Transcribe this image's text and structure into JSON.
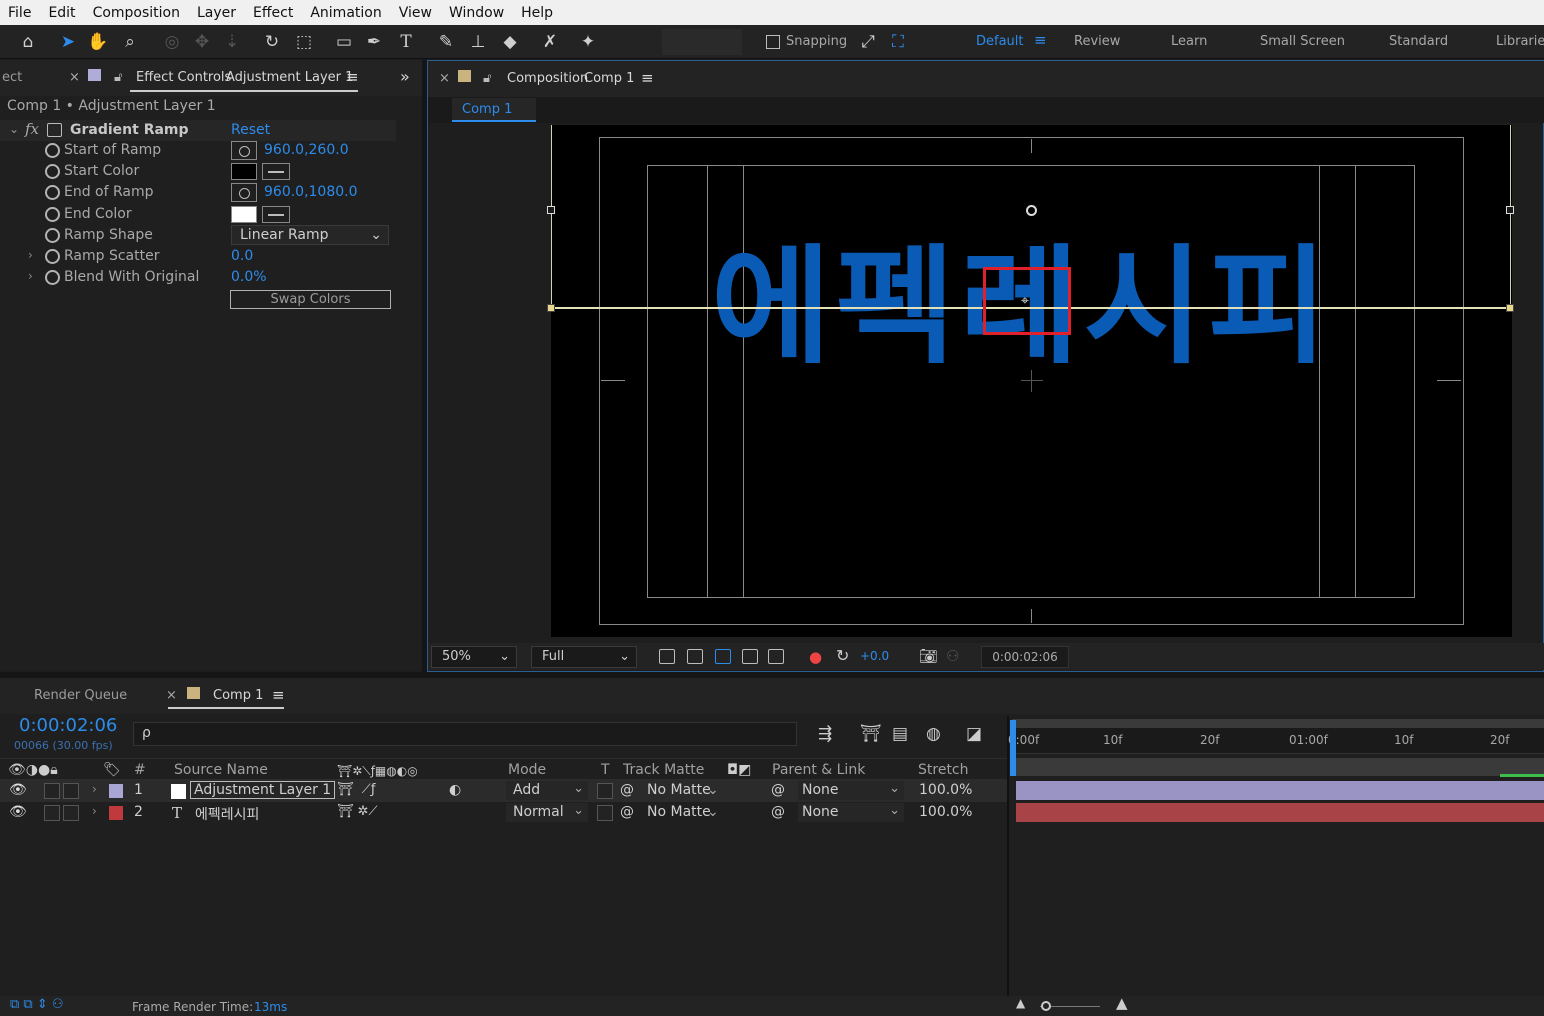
{
  "menu": [
    "File",
    "Edit",
    "Composition",
    "Layer",
    "Effect",
    "Animation",
    "View",
    "Window",
    "Help"
  ],
  "toolbar": {
    "snapping_label": "Snapping",
    "workspaces": [
      "Default",
      "Review",
      "Learn",
      "Small Screen",
      "Standard",
      "Libraries"
    ],
    "active_workspace": "Default"
  },
  "effect_controls": {
    "cut_tab": "ect",
    "tab_label": "Effect Controls",
    "tab_layer": "Adjustment Layer 1",
    "breadcrumb": "Comp 1 • Adjustment Layer 1",
    "effect_name": "Gradient Ramp",
    "reset_label": "Reset",
    "fx_label": "fx",
    "props": {
      "start_of_ramp": {
        "label": "Start of Ramp",
        "value": "960.0,260.0"
      },
      "start_color": {
        "label": "Start Color",
        "color": "#000000"
      },
      "end_of_ramp": {
        "label": "End of Ramp",
        "value": "960.0,1080.0"
      },
      "end_color": {
        "label": "End Color",
        "color": "#ffffff"
      },
      "ramp_shape": {
        "label": "Ramp Shape",
        "value": "Linear Ramp"
      },
      "ramp_scatter": {
        "label": "Ramp Scatter",
        "value": "0.0"
      },
      "blend_with_original": {
        "label": "Blend With Original",
        "value": "0.0%"
      }
    },
    "swap_colors_label": "Swap Colors"
  },
  "composition": {
    "tab_label": "Composition",
    "tab_comp": "Comp 1",
    "sub_tab": "Comp 1",
    "text": "에펙레시피",
    "text_color": "#0a5bb5",
    "highlight_color": "#e0202a",
    "zoom": "50%",
    "resolution": "Full",
    "exposure": "+0.0",
    "timecode": "0:00:02:06"
  },
  "timeline": {
    "render_queue_tab": "Render Queue",
    "comp_tab": "Comp 1",
    "timecode": "0:00:02:06",
    "frame_info": "00066 (30.00 fps)",
    "search_icon_label": "ρ",
    "columns": {
      "num": "#",
      "source_name": "Source Name",
      "mode": "Mode",
      "t": "T",
      "track_matte": "Track Matte",
      "parent_link": "Parent & Link",
      "stretch": "Stretch"
    },
    "ruler_labels": [
      "0:00f",
      "10f",
      "20f",
      "01:00f",
      "10f",
      "20f"
    ],
    "layers": [
      {
        "num": "1",
        "name": "Adjustment Layer 1",
        "label_color": "#a9a6d6",
        "mode": "Add",
        "matte": "No Matte",
        "parent": "None",
        "stretch": "100.0%",
        "bar_color": "#9a94c4"
      },
      {
        "num": "2",
        "type": "T",
        "name": "에펙레시피",
        "label_color": "#c0393d",
        "mode": "Normal",
        "matte": "No Matte",
        "parent": "None",
        "stretch": "100.0%",
        "bar_color": "#a84448"
      }
    ]
  },
  "status": {
    "frame_render_label": "Frame Render Time:",
    "frame_render_value": "13ms"
  }
}
